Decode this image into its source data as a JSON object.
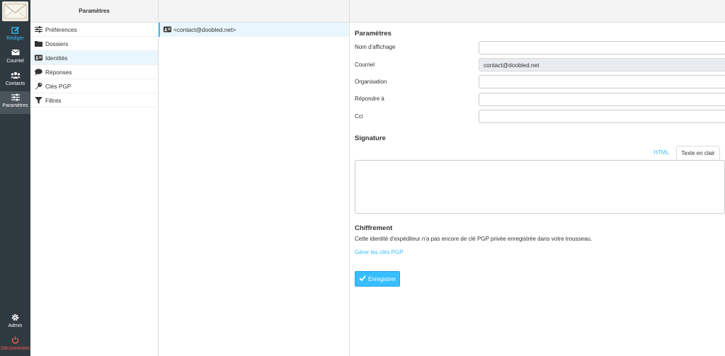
{
  "rail": {
    "items": [
      {
        "label": "Rédiger",
        "icon": "compose-icon"
      },
      {
        "label": "Courriel",
        "icon": "mail-icon"
      },
      {
        "label": "Contacts",
        "icon": "contacts-icon"
      },
      {
        "label": "Paramètres",
        "icon": "settings-sliders-icon"
      }
    ],
    "admin": "Admin",
    "logout": "Déconnexion"
  },
  "settings": {
    "title": "Paramètres",
    "items": [
      {
        "label": "Préférences",
        "icon": "sliders-icon"
      },
      {
        "label": "Dossiers",
        "icon": "folder-icon"
      },
      {
        "label": "Identités",
        "icon": "id-card-icon"
      },
      {
        "label": "Réponses",
        "icon": "speech-bubble-icon"
      },
      {
        "label": "Clés PGP",
        "icon": "key-icon"
      },
      {
        "label": "Filtres",
        "icon": "filter-icon"
      }
    ]
  },
  "identities": {
    "items": [
      {
        "label": "<contact@doobled.net>"
      }
    ]
  },
  "form": {
    "section_title": "Paramètres",
    "display_name_label": "Nom d'affichage",
    "display_name_value": "",
    "email_label": "Courriel",
    "email_value": "contact@doobled.net",
    "organization_label": "Organisation",
    "organization_value": "",
    "reply_to_label": "Répondre à",
    "reply_to_value": "",
    "bcc_label": "Cci",
    "bcc_value": "",
    "signature_title": "Signature",
    "tab_html": "HTML",
    "tab_plain": "Texte en clair",
    "encryption_title": "Chiffrement",
    "encryption_text": "Cette identité d'expéditeur n'a pas encore de clé PGP privée enregistrée dans votre trousseau.",
    "manage_pgp_link": "Gérer les clés PGP",
    "save_label": "Enregistrer"
  },
  "colors": {
    "accent": "#37beff",
    "rail": "#2f3a40",
    "logout": "#ff5552"
  }
}
